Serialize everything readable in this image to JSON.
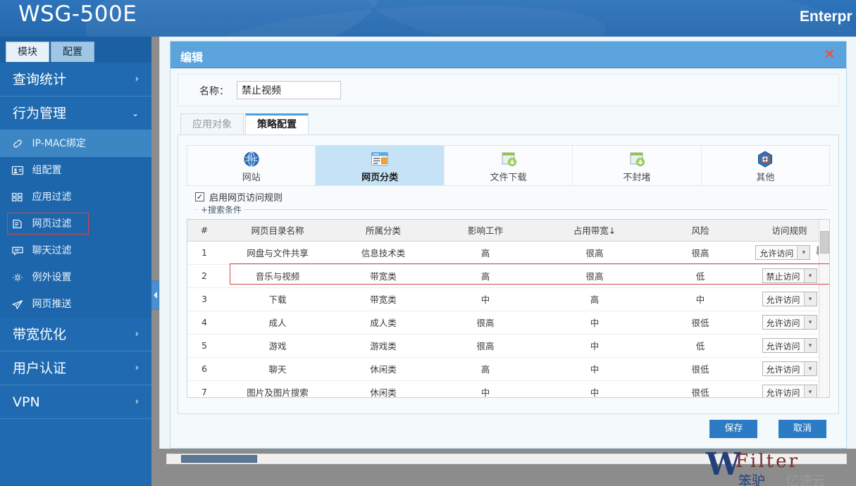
{
  "brand": {
    "product": "WSG-500E",
    "right_text": "Enterpr"
  },
  "sidebar": {
    "tabs": [
      {
        "label": "模块",
        "active": true
      },
      {
        "label": "配置",
        "active": false
      }
    ],
    "groups": [
      {
        "label": "查询统计",
        "chevron": "›",
        "expanded": false
      },
      {
        "label": "行为管理",
        "chevron": "⌄",
        "expanded": true
      },
      {
        "label": "带宽优化",
        "chevron": "›",
        "expanded": false
      },
      {
        "label": "用户认证",
        "chevron": "›",
        "expanded": false
      },
      {
        "label": "VPN",
        "chevron": "›",
        "expanded": false
      }
    ],
    "sub_items": [
      {
        "label": "IP-MAC绑定",
        "icon": "link-icon",
        "active": true,
        "highlighted": false
      },
      {
        "label": "组配置",
        "icon": "id-card-icon",
        "active": false,
        "highlighted": false
      },
      {
        "label": "应用过滤",
        "icon": "grid-icon",
        "active": false,
        "highlighted": false
      },
      {
        "label": "网页过滤",
        "icon": "page-icon",
        "active": false,
        "highlighted": true
      },
      {
        "label": "聊天过滤",
        "icon": "chat-bubble-icon",
        "active": false,
        "highlighted": false
      },
      {
        "label": "例外设置",
        "icon": "gear-icon",
        "active": false,
        "highlighted": false
      },
      {
        "label": "网页推送",
        "icon": "paper-plane-icon",
        "active": false,
        "highlighted": false
      }
    ],
    "collapse_handle": "◀"
  },
  "dialog": {
    "title": "编辑",
    "close_label": "✕",
    "name_label": "名称：",
    "name_value": "禁止视频",
    "name_placeholder": "",
    "tabs": [
      {
        "label": "应用对象",
        "active": false
      },
      {
        "label": "策略配置",
        "active": true
      }
    ],
    "icon_tabs": [
      {
        "label": "网站",
        "icon": "globe-icon",
        "active": false
      },
      {
        "label": "网页分类",
        "icon": "webpage-category-icon",
        "active": true
      },
      {
        "label": "文件下载",
        "icon": "file-download-icon",
        "active": false
      },
      {
        "label": "不封堵",
        "icon": "file-download-icon",
        "active": false
      },
      {
        "label": "其他",
        "icon": "hexagon-plus-icon",
        "active": false
      }
    ],
    "enable_rule": {
      "label": "启用网页访问规则",
      "checked": true,
      "check_glyph": "✓"
    },
    "search_legend": "+搜索条件",
    "footer": {
      "save_label": "保存",
      "cancel_label": "取消"
    }
  },
  "table": {
    "columns": [
      "#",
      "网页目录名称",
      "所属分类",
      "影响工作",
      "占用带宽↓",
      "风险",
      "访问规则"
    ],
    "rows": [
      {
        "idx": "1",
        "name": "网盘与文件共享",
        "category": "信息技术类",
        "work": "高",
        "bandwidth": "很高",
        "risk": "很高",
        "rule": "允许访问",
        "selected": false,
        "has_download_arrow": true
      },
      {
        "idx": "2",
        "name": "音乐与视频",
        "category": "带宽类",
        "work": "高",
        "bandwidth": "很高",
        "risk": "低",
        "rule": "禁止访问",
        "selected": true,
        "has_download_arrow": false
      },
      {
        "idx": "3",
        "name": "下载",
        "category": "带宽类",
        "work": "中",
        "bandwidth": "高",
        "risk": "中",
        "rule": "允许访问",
        "selected": false,
        "has_download_arrow": false
      },
      {
        "idx": "4",
        "name": "成人",
        "category": "成人类",
        "work": "很高",
        "bandwidth": "中",
        "risk": "很低",
        "rule": "允许访问",
        "selected": false,
        "has_download_arrow": false
      },
      {
        "idx": "5",
        "name": "游戏",
        "category": "游戏类",
        "work": "很高",
        "bandwidth": "中",
        "risk": "低",
        "rule": "允许访问",
        "selected": false,
        "has_download_arrow": false
      },
      {
        "idx": "6",
        "name": "聊天",
        "category": "休闲类",
        "work": "高",
        "bandwidth": "中",
        "risk": "很低",
        "rule": "允许访问",
        "selected": false,
        "has_download_arrow": false
      },
      {
        "idx": "7",
        "name": "图片及图片搜索",
        "category": "休闲类",
        "work": "中",
        "bandwidth": "中",
        "risk": "很低",
        "rule": "允许访问",
        "selected": false,
        "has_download_arrow": false
      }
    ],
    "scroll_up": "⌃",
    "scroll_down": "⌄"
  },
  "watermark": {
    "w": "W",
    "filter": "Filter",
    "cn": "笨驴",
    "ys": "亿速云",
    "ring": "൬"
  },
  "colors": {
    "brand_blue": "#2a6fb5",
    "sidebar_blue": "#1f6ab0",
    "accent": "#5ba3dd",
    "highlight_red": "#d4483f",
    "button_blue": "#2b7cc4",
    "active_tab_bg": "#c6e2f7"
  }
}
